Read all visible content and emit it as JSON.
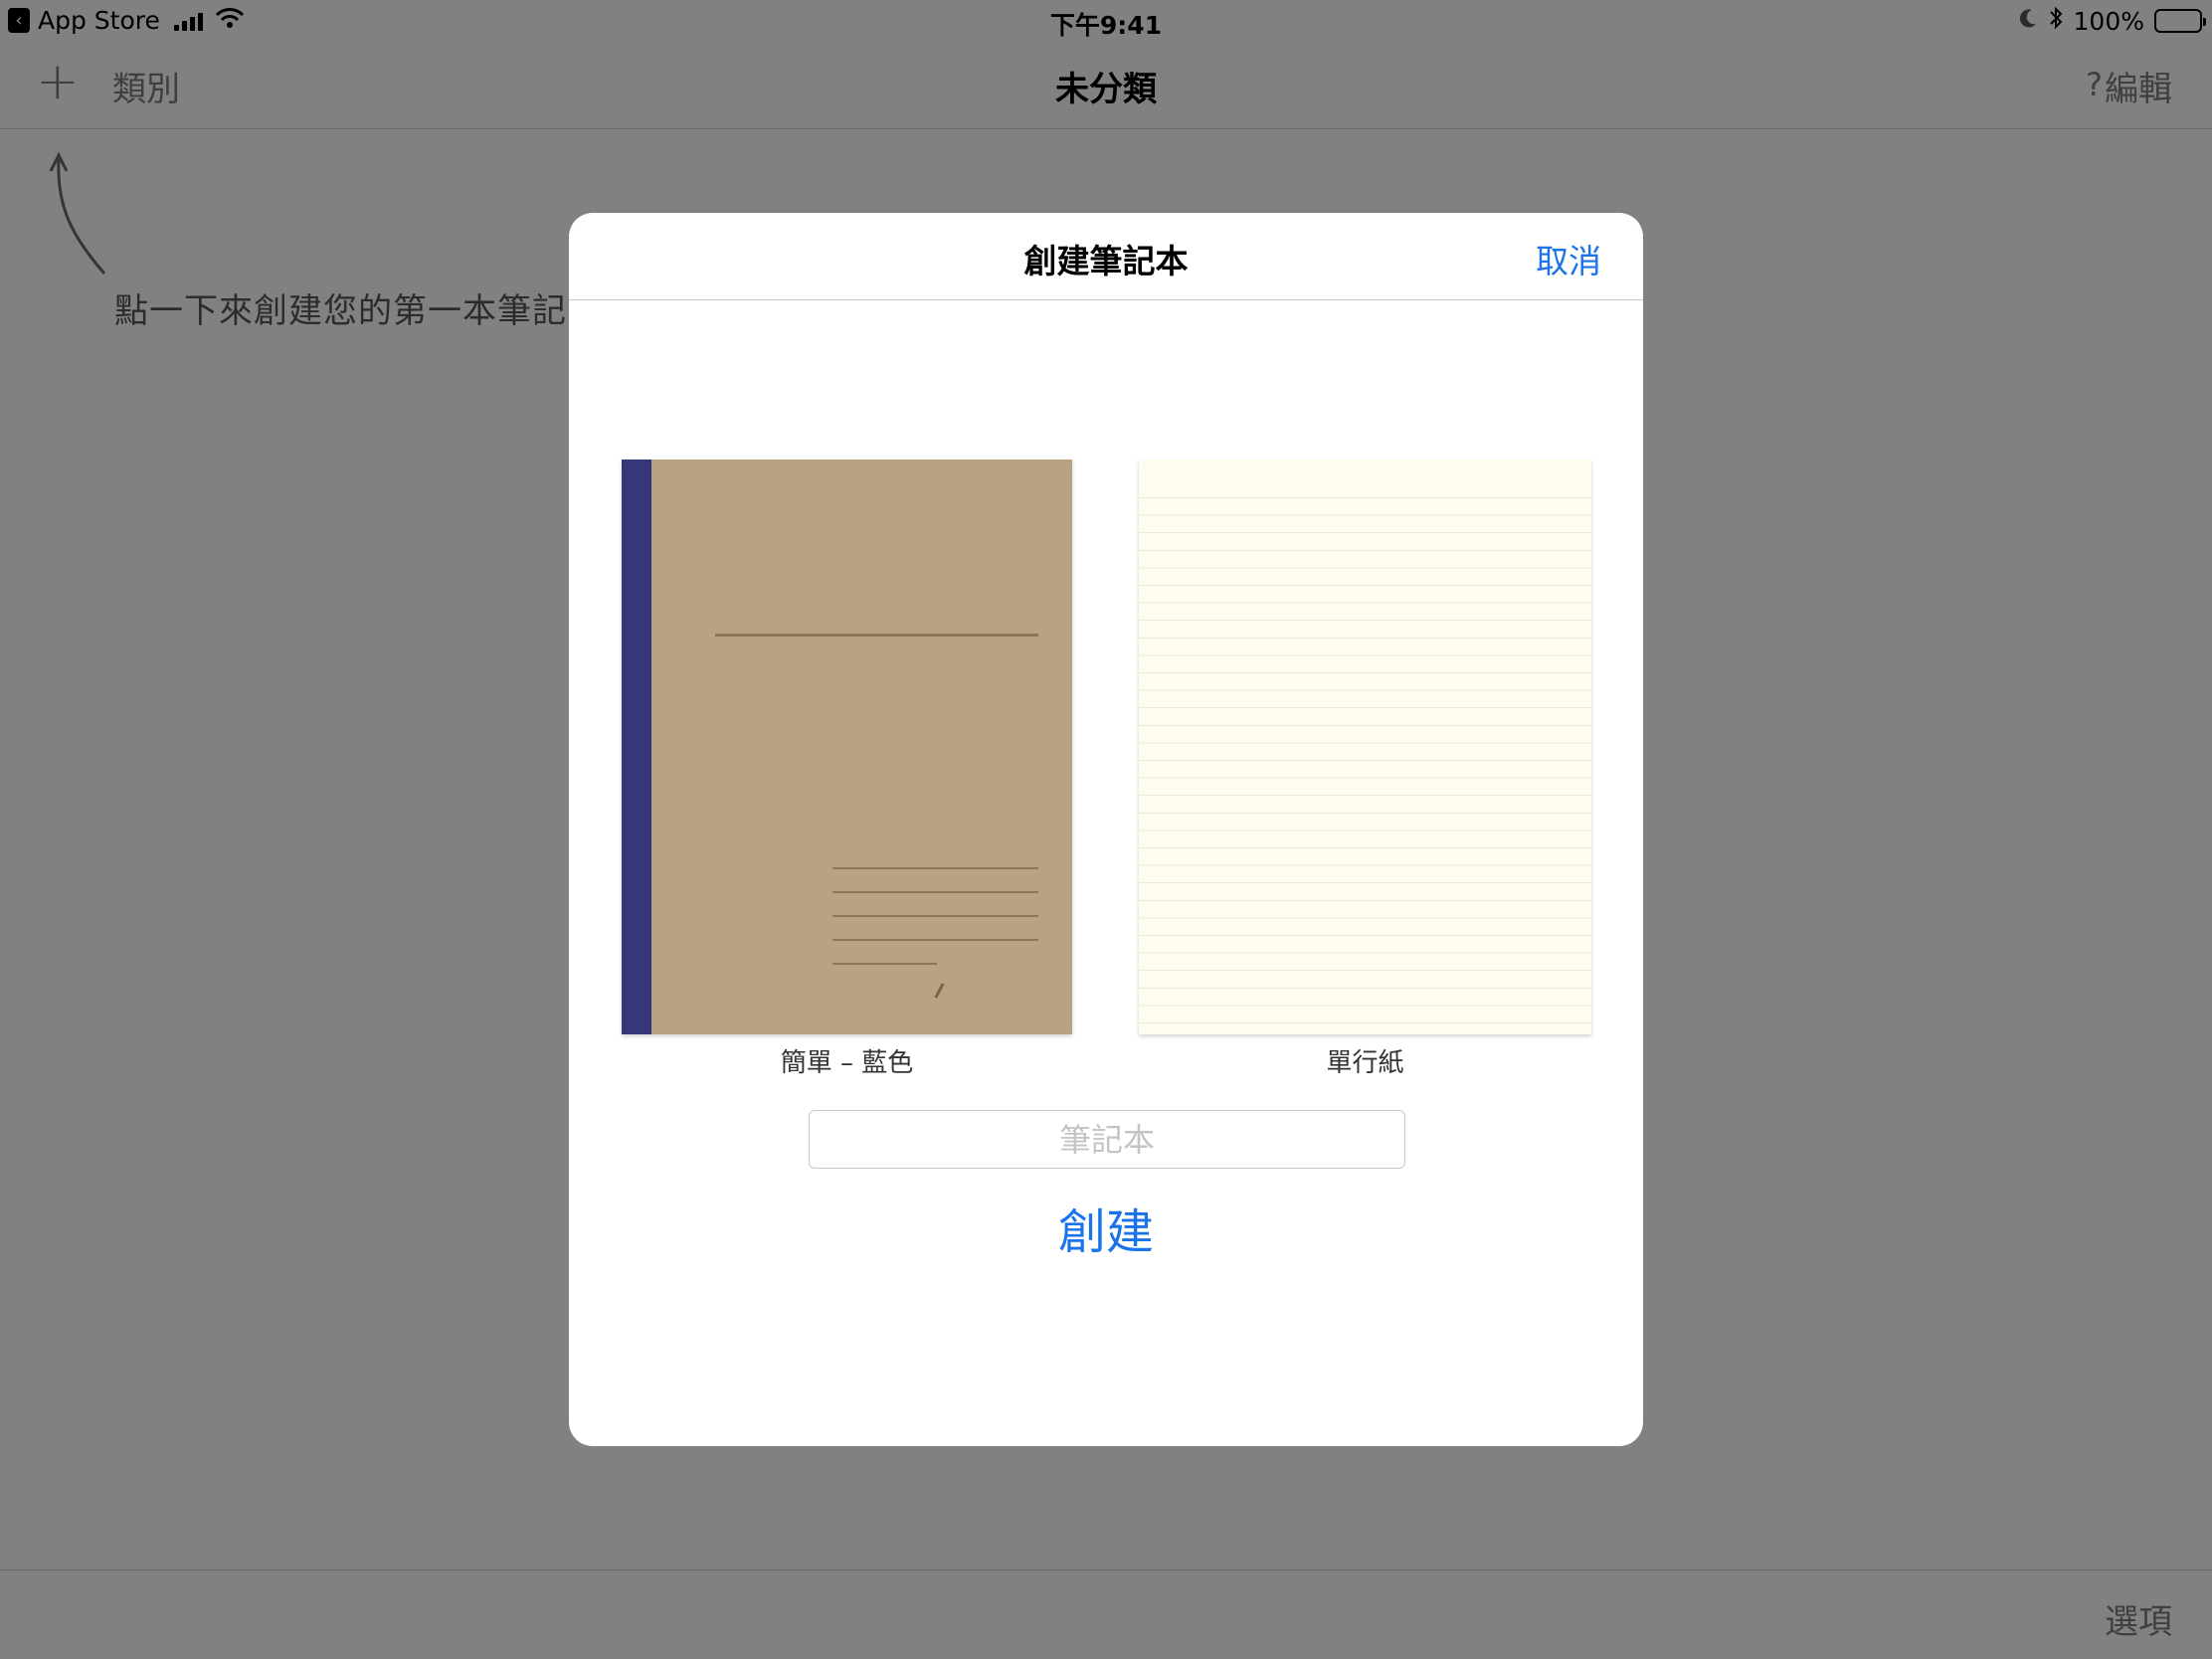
{
  "status_bar": {
    "back_app": "App Store",
    "time": "下午9:41",
    "battery": "100%"
  },
  "nav_bar": {
    "add_icon": "plus-icon",
    "category_label": "類別",
    "title": "未分類",
    "help_label": "?",
    "edit_label": "編輯"
  },
  "hint": {
    "text": "點一下來創建您的第一本筆記"
  },
  "toolbar": {
    "options_label": "選項"
  },
  "modal": {
    "title": "創建筆記本",
    "cancel_label": "取消",
    "templates": [
      {
        "label": "簡單 – 藍色",
        "spine_color": "#36377a",
        "cover_color": "#b9a282"
      },
      {
        "label": "單行紙",
        "paper_color": "#fefcec"
      }
    ],
    "name_input": {
      "placeholder": "筆記本",
      "value": ""
    },
    "create_label": "創建"
  },
  "colors": {
    "accent": "#1a73e8",
    "dim_overlay": "rgba(0,0,0,0.48)"
  }
}
